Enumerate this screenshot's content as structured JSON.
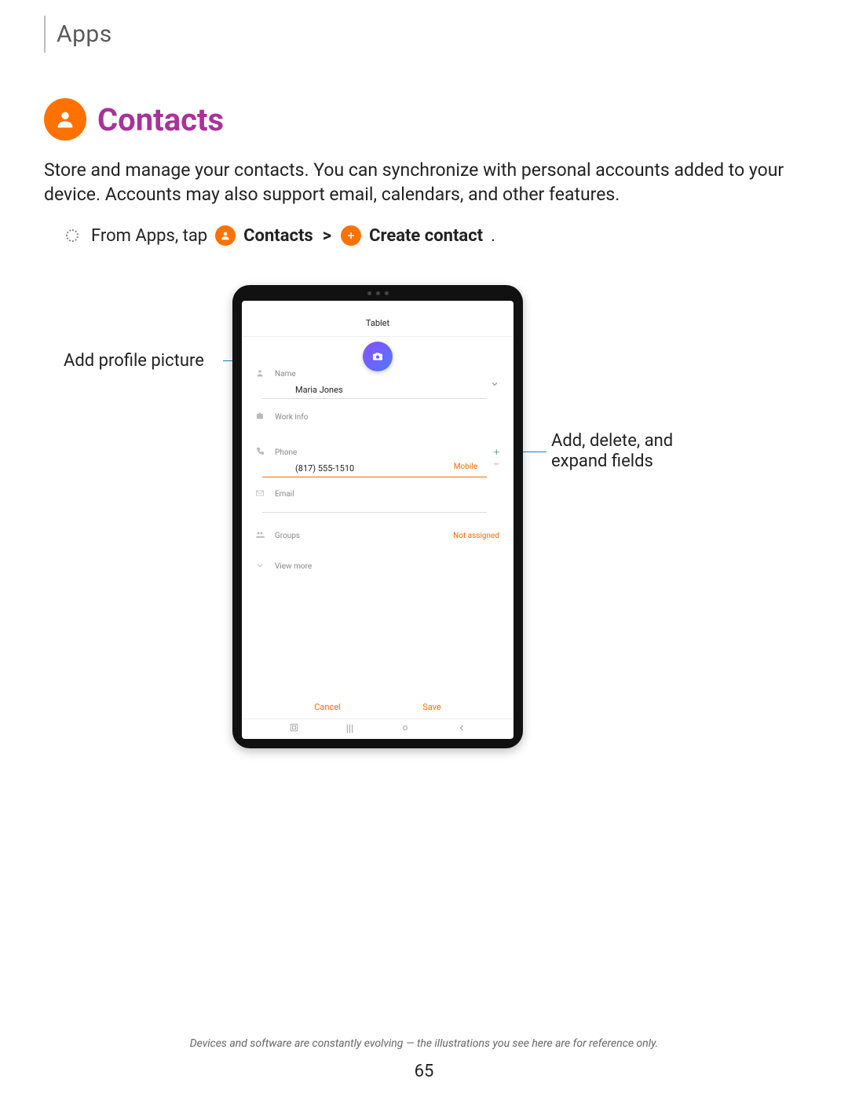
{
  "section": "Apps",
  "title": "Contacts",
  "intro": "Store and manage your contacts. You can synchronize with personal accounts added to your device. Accounts may also support email, calendars, and other features.",
  "step": {
    "prefix": "From Apps, tap",
    "app_label": "Contacts",
    "action_label": "Create contact",
    "separator": ">",
    "period": "."
  },
  "callouts": {
    "profile_picture": "Add profile picture",
    "fields": "Add, delete, and expand fields"
  },
  "device": {
    "header": "Tablet",
    "fields": {
      "name_label": "Name",
      "name_value": "Maria Jones",
      "work_label": "Work info",
      "phone_label": "Phone",
      "phone_value": "(817) 555-1510",
      "phone_type": "Mobile",
      "email_label": "Email",
      "groups_label": "Groups",
      "groups_value": "Not assigned",
      "viewmore": "View more"
    },
    "buttons": {
      "cancel": "Cancel",
      "save": "Save"
    }
  },
  "footnote": "Devices and software are constantly evolving — the illustrations you see here are for reference only.",
  "page_number": "65"
}
